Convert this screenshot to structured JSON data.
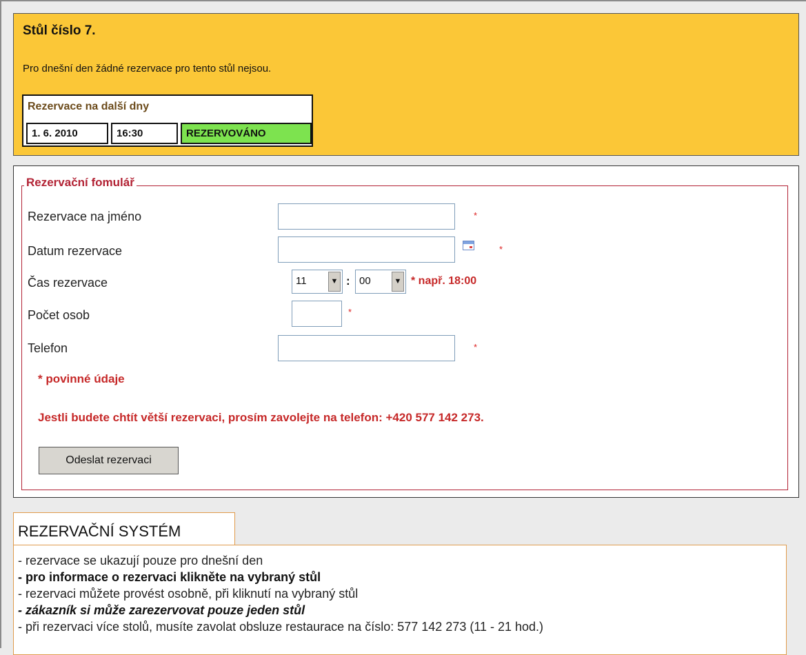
{
  "table": {
    "title": "Stůl číslo 7.",
    "note": "Pro dnešní den žádné rezervace pro tento stůl nejsou.",
    "future_reservations": {
      "title": "Rezervace na další dny",
      "rows": [
        {
          "date": "1. 6. 2010",
          "time": "16:30",
          "status": "REZERVOVÁNO"
        }
      ]
    }
  },
  "form": {
    "legend": "Rezervační fomulář",
    "fields": {
      "name": {
        "label": "Rezervace na jméno",
        "value": ""
      },
      "date": {
        "label": "Datum rezervace",
        "value": ""
      },
      "time": {
        "label": "Čas rezervace",
        "hour": "11",
        "minute": "00",
        "note": "* např. 18:00"
      },
      "persons": {
        "label": "Počet osob",
        "value": ""
      },
      "phone": {
        "label": "Telefon",
        "value": ""
      }
    },
    "required_mark": "*",
    "required_note": "* povinné údaje",
    "phone_note": "Jestli budete chtít větší rezervaci, prosím zavolejte na telefon: +420 577 142 273.",
    "submit_label": "Odeslat rezervaci"
  },
  "info": {
    "title": "REZERVAČNÍ SYSTÉM",
    "lines": [
      "- rezervace se ukazují pouze pro dnešní den",
      "- pro informace o rezervaci klikněte na vybraný stůl",
      "- rezervaci můžete provést osobně, při kliknutí na vybraný stůl",
      "- zákazník si může zarezervovat pouze jeden stůl",
      "- při rezervaci více stolů, musíte zavolat obsluze restaurace na číslo: 577 142 273 (11 - 21 hod.)"
    ]
  },
  "colors": {
    "table_panel_bg": "#fbc737",
    "reserved_status_bg": "#7de34f",
    "form_accent": "#b22234",
    "info_border": "#e09a4a"
  }
}
